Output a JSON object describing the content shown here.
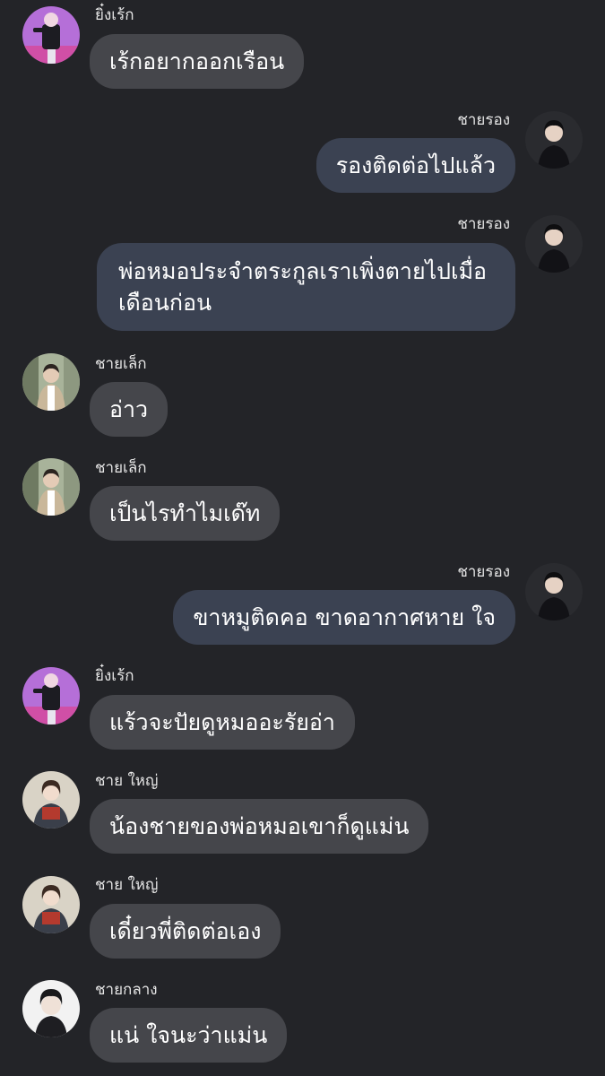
{
  "messages": [
    {
      "sender": "ยิ๋งเร้ก",
      "text": "เร้กอยากออกเรือน",
      "side": "left",
      "avatar": "purple-dancer-avatar"
    },
    {
      "sender": "ชายรอง",
      "text": "รองติดต่อไปแล้ว",
      "side": "right",
      "avatar": "dark-suit-avatar"
    },
    {
      "sender": "ชายรอง",
      "text": "พ่อหมอประจำตระกูลเราเพิ่งตายไปเมื่อ\nเดือนก่อน",
      "side": "right",
      "avatar": "dark-suit-avatar"
    },
    {
      "sender": "ชายเล็ก",
      "text": "อ่าว",
      "side": "left",
      "avatar": "window-jacket-avatar"
    },
    {
      "sender": "ชายเล็ก",
      "text": "เป็นไรทำไมเด๊ท",
      "side": "left",
      "avatar": "window-jacket-avatar"
    },
    {
      "sender": "ชายรอง",
      "text": "ขาหมูติดคอ ขาดอากาศหาย ใจ",
      "side": "right",
      "avatar": "dark-suit-avatar"
    },
    {
      "sender": "ยิ๋งเร้ก",
      "text": "แร้วจะปัยดูหมออะรัยอ่า",
      "side": "left",
      "avatar": "purple-dancer-avatar"
    },
    {
      "sender": "ชาย ใหญ่",
      "text": "น้องชายของพ่อหมอเขาก็ดูแม่น",
      "side": "left",
      "avatar": "book-reader-avatar"
    },
    {
      "sender": "ชาย ใหญ่",
      "text": "เดี๋ยวพี่ติดต่อเอง",
      "side": "left",
      "avatar": "book-reader-avatar"
    },
    {
      "sender": "ชายกลาง",
      "text": "แน่ ใจนะว่าแม่น",
      "side": "left",
      "avatar": "white-portrait-avatar"
    }
  ],
  "colors": {
    "background": "#232428",
    "incoming_bubble": "#45464b",
    "outgoing_bubble": "#3b4252",
    "text": "#ffffff",
    "name_text": "#e6e6e6"
  }
}
